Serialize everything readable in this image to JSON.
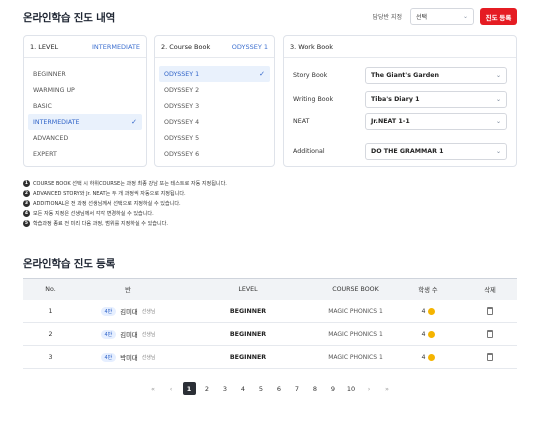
{
  "header": {
    "title": "온라인학습 진도 내역",
    "school_label": "담당반 지정",
    "school_select": "선택",
    "register_button": "진도 등록"
  },
  "level_panel": {
    "title": "1. LEVEL",
    "current": "INTERMEDIATE",
    "items": [
      "BEGINNER",
      "WARMING UP",
      "BASIC",
      "INTERMEDIATE",
      "ADVANCED",
      "EXPERT"
    ],
    "selected": "INTERMEDIATE"
  },
  "course_panel": {
    "title": "2. Course Book",
    "current": "ODYSSEY 1",
    "items": [
      "ODYSSEY 1",
      "ODYSSEY 2",
      "ODYSSEY 3",
      "ODYSSEY 4",
      "ODYSSEY 5",
      "ODYSSEY 6"
    ],
    "selected": "ODYSSEY 1"
  },
  "workbook_panel": {
    "title": "3. Work Book",
    "rows": [
      {
        "label": "Story Book",
        "value": "The Giant's Garden"
      },
      {
        "label": "Writing Book",
        "value": "Tiba's Diary 1"
      },
      {
        "label": "NEAT",
        "value": "Jr.NEAT 1-1"
      },
      {
        "label": "Additional",
        "value": "DO THE GRAMMAR 1"
      }
    ]
  },
  "notes": [
    "COURSE BOOK 선택 시 하위COURSE는 과정 최종 강남 또는 테스트로 자동 지정됩니다.",
    "ADVANCED STORY와 Jr. NEAT는 두 개 과정씩 자동으로 지정됩니다.",
    "ADDITIONAL은 전 과정 선생님께서 선택으로 지정하실 수 있습니다.",
    "모든 자동 지정은 선생님께서 각각 변경하실 수 있습니다.",
    "학습과정 종료 전 미리 다음 과정, 범위를 지정하실 수 있습니다."
  ],
  "progress": {
    "title": "온라인학습 진도 등록",
    "columns": [
      "No.",
      "반",
      "LEVEL",
      "COURSE BOOK",
      "학생 수",
      "삭제"
    ],
    "rows": [
      {
        "no": "1",
        "badge": "4반",
        "teacher": "김미대",
        "suffix": "선생님",
        "level": "BEGINNER",
        "course": "MAGIC PHONICS 1",
        "count": "4"
      },
      {
        "no": "2",
        "badge": "4반",
        "teacher": "김미대",
        "suffix": "선생님",
        "level": "BEGINNER",
        "course": "MAGIC PHONICS 1",
        "count": "4"
      },
      {
        "no": "3",
        "badge": "4반",
        "teacher": "박미대",
        "suffix": "선생님",
        "level": "BEGINNER",
        "course": "MAGIC PHONICS 1",
        "count": "4"
      }
    ]
  },
  "pagination": {
    "first": "«",
    "prev": "‹",
    "pages": [
      "1",
      "2",
      "3",
      "4",
      "5",
      "6",
      "7",
      "8",
      "9",
      "10"
    ],
    "current": "1",
    "next": "›",
    "last": "»"
  },
  "colors": {
    "accent": "#2f63c8",
    "primary_button": "#e51c23",
    "coin": "#f5b400"
  }
}
